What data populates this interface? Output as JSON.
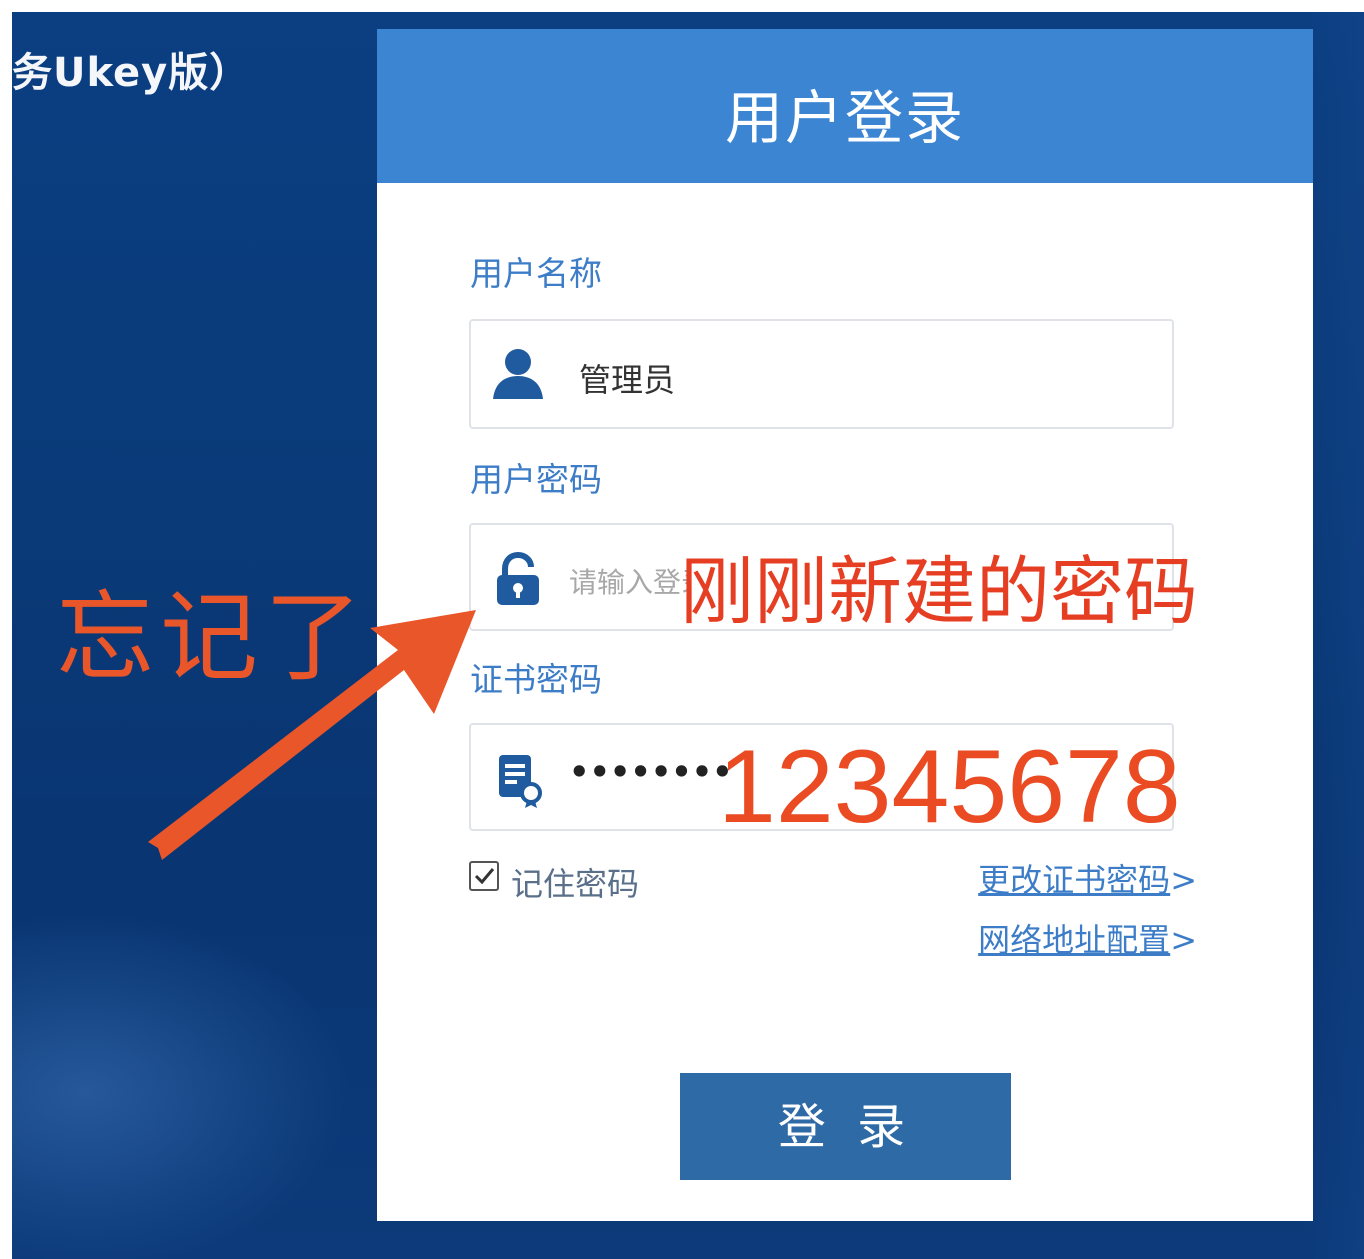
{
  "app": {
    "title_partial": "务Ukey版）"
  },
  "panel": {
    "title": "用户登录",
    "username": {
      "label": "用户名称",
      "value": "管理员",
      "icon": "user-icon"
    },
    "password": {
      "label": "用户密码",
      "placeholder": "请输入登录",
      "icon": "lock-icon"
    },
    "cert_password": {
      "label": "证书密码",
      "value": "••••••••",
      "icon": "certificate-icon"
    },
    "remember": {
      "label": "记住密码",
      "checked": true
    },
    "links": [
      {
        "label": "更改证书密码",
        "suffix": ">"
      },
      {
        "label": "网络地址配置",
        "suffix": ">"
      }
    ],
    "login_button": "登 录"
  },
  "annotations": {
    "forgot": "忘记了",
    "new_password_note": "刚刚新建的密码",
    "cert_password_note": "12345678",
    "arrow_color": "#e8562a"
  },
  "colors": {
    "background": "#0a3a78",
    "header": "#3b85d3",
    "button": "#2d6aa6",
    "label": "#3d7dc8"
  }
}
